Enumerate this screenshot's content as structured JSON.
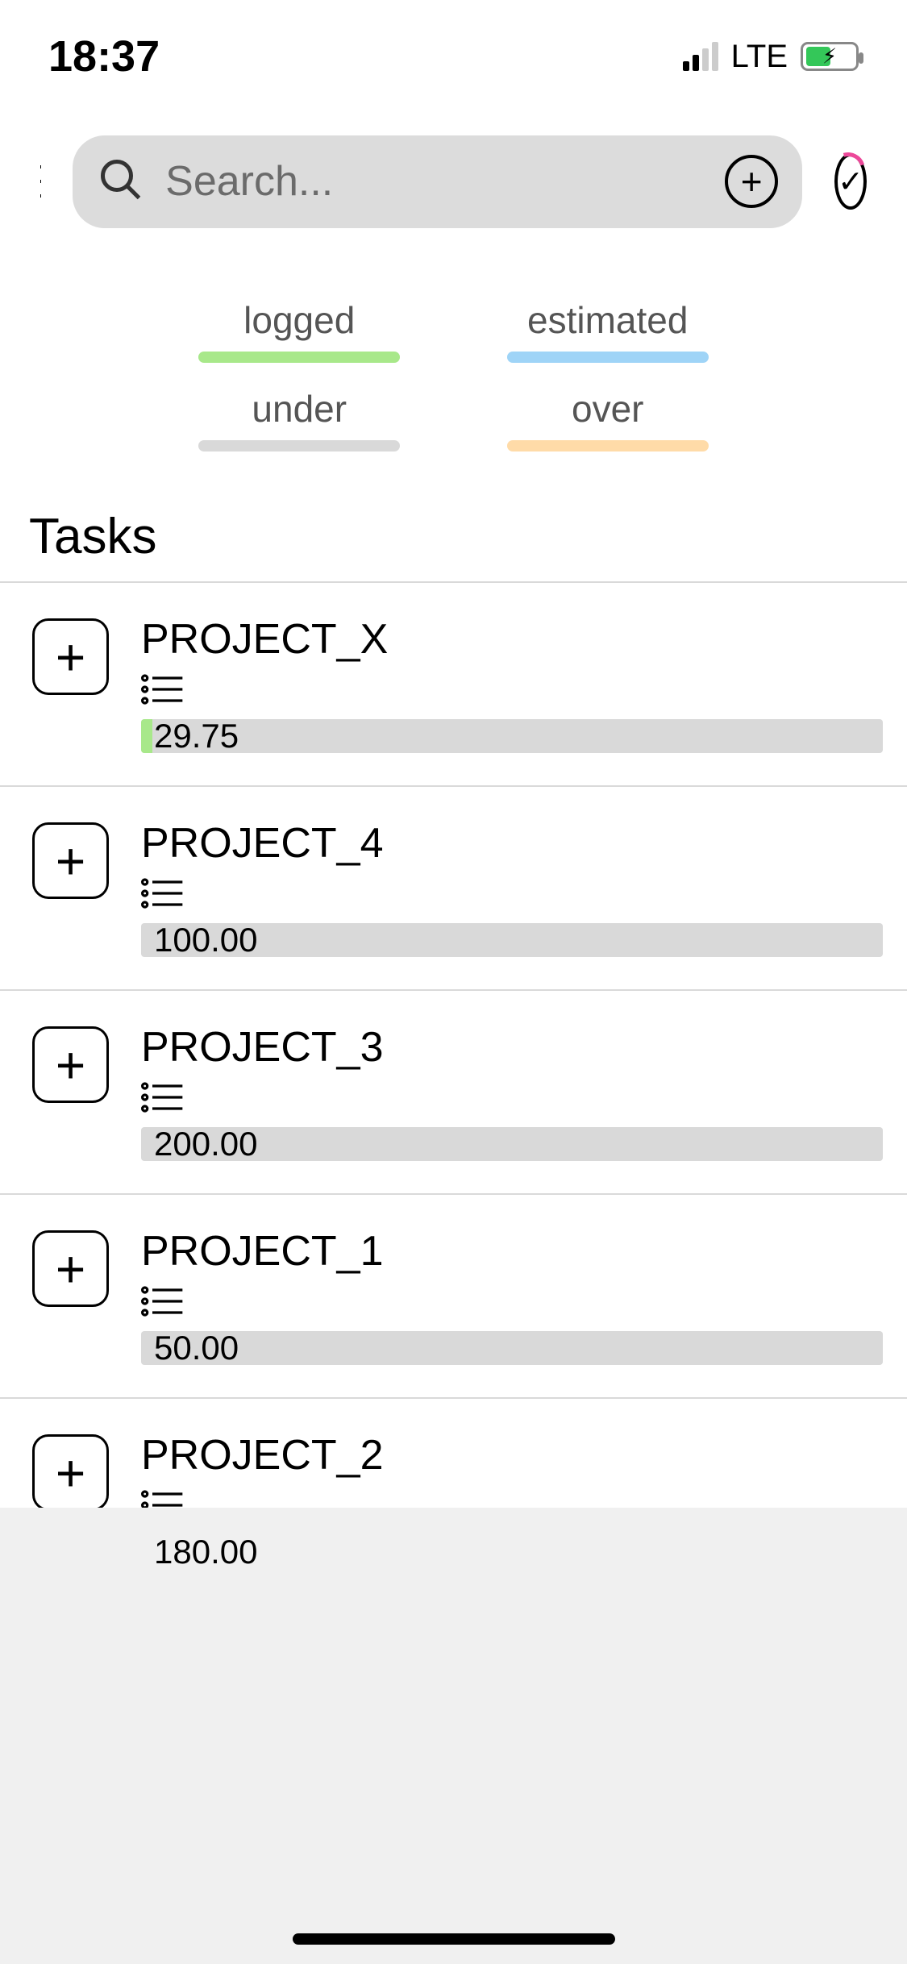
{
  "status": {
    "time": "18:37",
    "network": "LTE"
  },
  "search": {
    "placeholder": "Search..."
  },
  "legend": [
    {
      "label": "logged",
      "colorClass": "c-green"
    },
    {
      "label": "estimated",
      "colorClass": "c-blue"
    },
    {
      "label": "under",
      "colorClass": "c-gray"
    },
    {
      "label": "over",
      "colorClass": "c-orange"
    }
  ],
  "section_title": "Tasks",
  "tasks": [
    {
      "name": "PROJECT_X",
      "value": "29.75",
      "logged_pct": 1.5
    },
    {
      "name": "PROJECT_4",
      "value": "100.00",
      "logged_pct": 0
    },
    {
      "name": "PROJECT_3",
      "value": "200.00",
      "logged_pct": 0
    },
    {
      "name": "PROJECT_1",
      "value": "50.00",
      "logged_pct": 0
    },
    {
      "name": "PROJECT_2",
      "value": "180.00",
      "logged_pct": 0
    }
  ]
}
